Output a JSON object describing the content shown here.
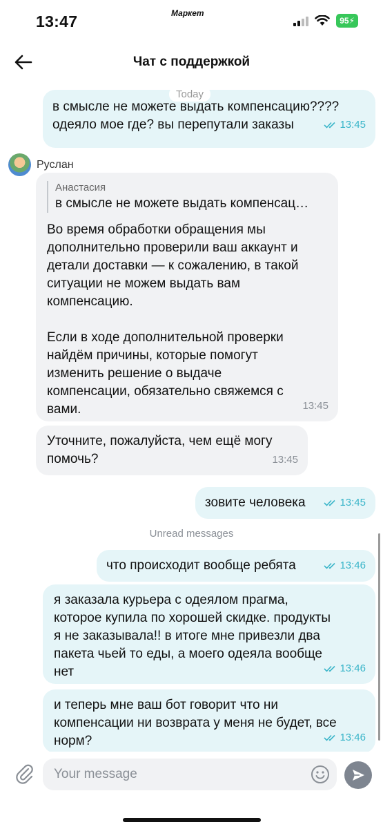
{
  "status_bar": {
    "time": "13:47",
    "app_name": "Маркет",
    "battery": "95"
  },
  "header": {
    "title": "Чат с поддержкой"
  },
  "chat": {
    "day_separator": "Today",
    "unread_separator": "Unread messages",
    "messages": [
      {
        "direction": "outgoing",
        "lines": [
          "в смысле не можете выдать компенсацию????",
          "одеяло мое где? вы перепутали заказы"
        ],
        "time": "13:45",
        "read": true
      },
      {
        "direction": "incoming",
        "sender": "Руслан",
        "quote_author": "Анастасия",
        "quote_text": "в смысле не можете выдать компенсац…",
        "lines": [
          "Во время обработки обращения мы",
          "дополнительно проверили ваш аккаунт и",
          "детали доставки — к сожалению, в такой",
          "ситуации не можем выдать вам",
          "компенсацию.",
          "",
          "Если в ходе дополнительной проверки",
          "найдём причины, которые помогут",
          "изменить решение о выдаче",
          "компенсации, обязательно свяжемся с",
          "вами."
        ],
        "time": "13:45"
      },
      {
        "direction": "incoming",
        "lines": [
          "Уточните, пожалуйста, чем ещё могу",
          "помочь?"
        ],
        "time": "13:45"
      },
      {
        "direction": "outgoing",
        "lines": [
          "зовите человека"
        ],
        "time": "13:45",
        "read": true
      },
      {
        "direction": "outgoing",
        "lines": [
          "что происходит вообще ребята"
        ],
        "time": "13:46",
        "read": true
      },
      {
        "direction": "outgoing",
        "lines": [
          "я заказала курьера с одеялом прагма,",
          "которое купила по хорошей скидке. продукты",
          "я не заказывала!! в итоге мне привезли два",
          "пакета чьей то еды, а моего одеяла вообще",
          "нет"
        ],
        "time": "13:46",
        "read": true
      },
      {
        "direction": "outgoing",
        "lines": [
          "и теперь мне ваш бот говорит что ни",
          "компенсации ни возврата у меня не будет, все",
          "норм?"
        ],
        "time": "13:46",
        "read": true
      }
    ]
  },
  "composer": {
    "placeholder": "Your message"
  },
  "colors": {
    "outgoing_bubble": "#e5f5f8",
    "incoming_bubble": "#f1f2f4",
    "time_outgoing": "#3ab5c9",
    "battery": "#37c75a"
  },
  "icons": {
    "back": "arrow-left-icon",
    "attach": "paperclip-icon",
    "emoji": "smiley-icon",
    "send": "send-icon",
    "read_status": "double-check-icon"
  }
}
